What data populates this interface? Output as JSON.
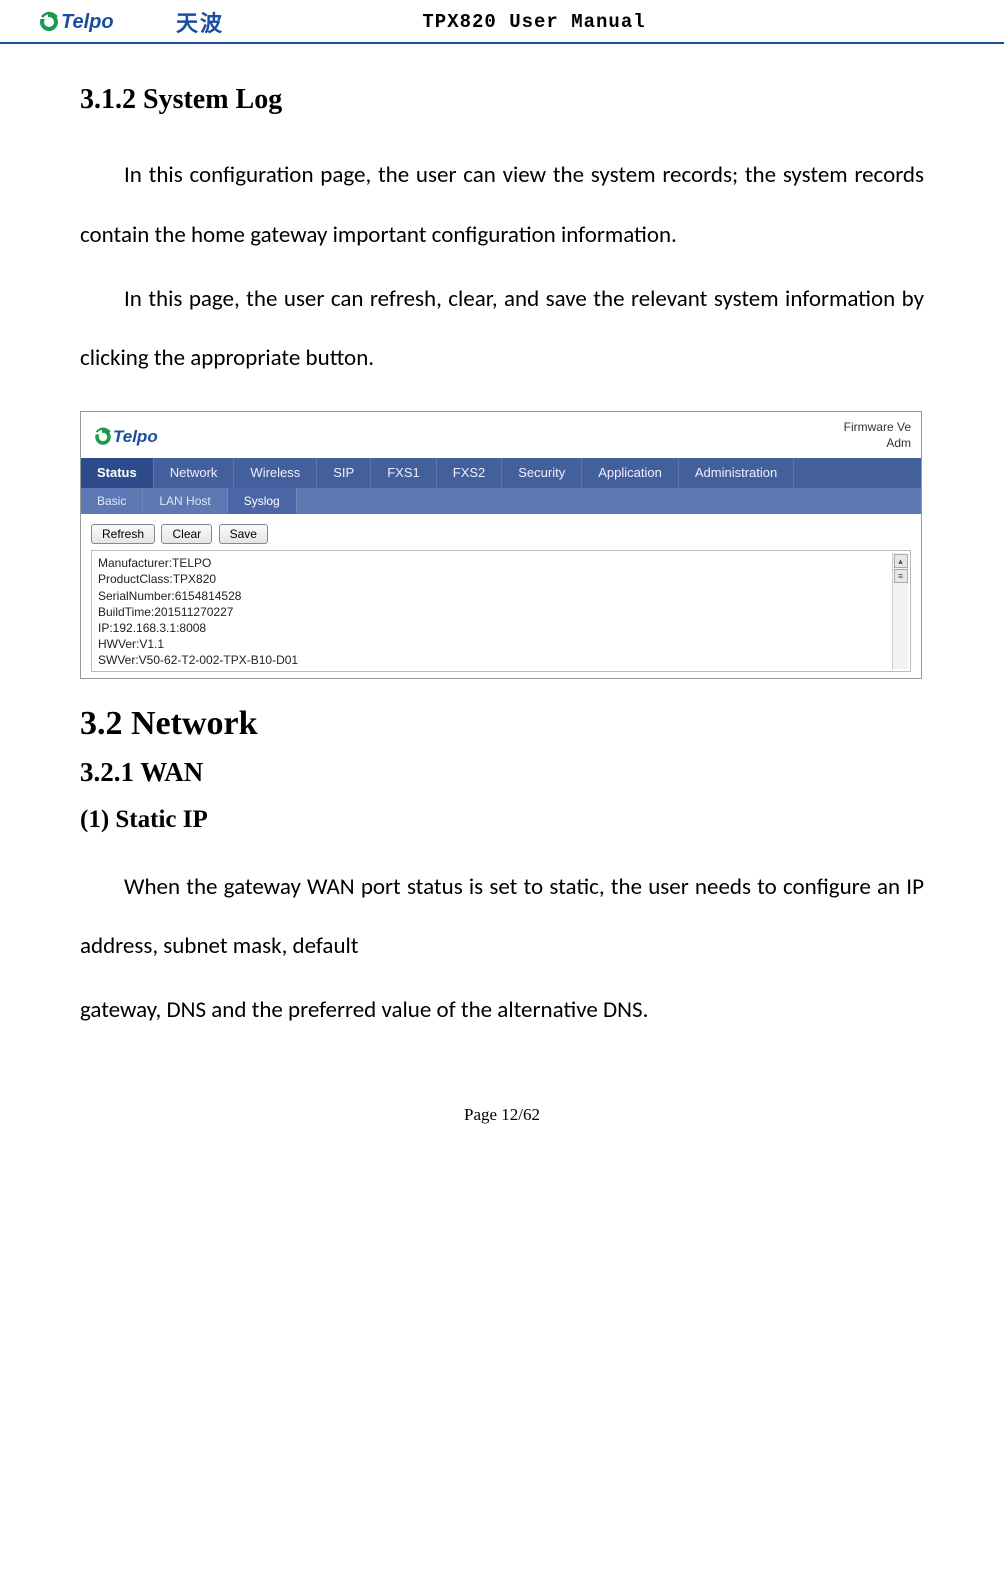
{
  "header": {
    "brand_cjk": "天波",
    "manual_title": "TPX820 User Manual"
  },
  "section312": {
    "heading": "3.1.2 System Log",
    "p1": "In this configuration page, the user can view the system records; the system records contain the home gateway important configuration information.",
    "p2": "In this page, the user can refresh, clear, and save the relevant system information by clicking the appropriate button."
  },
  "screenshot": {
    "firmware_line1": "Firmware Ve",
    "firmware_line2": "Adm",
    "tabs": {
      "status": "Status",
      "network": "Network",
      "wireless": "Wireless",
      "sip": "SIP",
      "fxs1": "FXS1",
      "fxs2": "FXS2",
      "security": "Security",
      "application": "Application",
      "administration": "Administration"
    },
    "subtabs": {
      "basic": "Basic",
      "lanhost": "LAN Host",
      "syslog": "Syslog"
    },
    "buttons": {
      "refresh": "Refresh",
      "clear": "Clear",
      "save": "Save"
    },
    "log_lines": {
      "l0": "Manufacturer:TELPO",
      "l1": "ProductClass:TPX820",
      "l2": "SerialNumber:6154814528",
      "l3": "BuildTime:201511270227",
      "l4": "IP:192.168.3.1:8008",
      "l5": "HWVer:V1.1",
      "l6": "SWVer:V50-62-T2-002-TPX-B10-D01"
    }
  },
  "section32": {
    "heading": "3.2 Network",
    "sub": "3.2.1 WAN",
    "subsub": "(1) Static IP",
    "p1": "When the gateway WAN port status is set to static, the user needs to configure an IP address, subnet mask, default",
    "p2": "gateway, DNS and the preferred value of the alternative DNS."
  },
  "footer": {
    "page": "Page 12/62"
  }
}
